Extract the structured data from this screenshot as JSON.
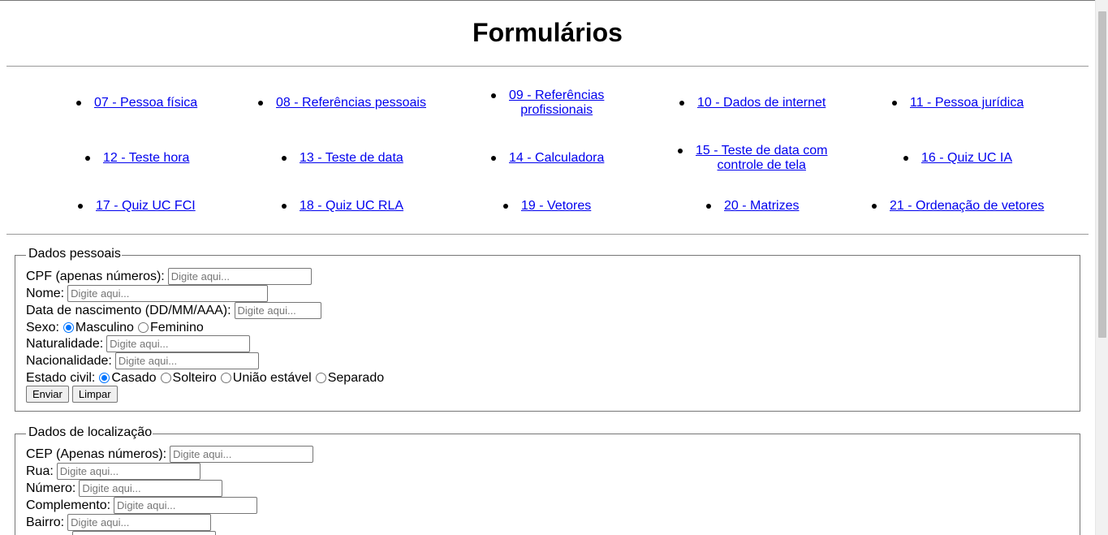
{
  "page": {
    "title": "Formulários"
  },
  "nav": {
    "links": [
      "07 - Pessoa física",
      "08 - Referências pessoais",
      [
        "09 - Referências",
        "profissionais"
      ],
      "10 - Dados de internet",
      "11 - Pessoa jurídica",
      "12 - Teste hora",
      "13 - Teste de data",
      "14 - Calculadora",
      [
        "15 - Teste de data com",
        "controle de tela"
      ],
      "16 - Quiz UC IA",
      "17 - Quiz UC FCI",
      "18 - Quiz UC RLA",
      "19 - Vetores",
      "20 - Matrizes",
      "21 - Ordenação de vetores"
    ]
  },
  "personal": {
    "legend": "Dados pessoais",
    "cpf_label": "CPF (apenas números):",
    "nome_label": "Nome:",
    "nascimento_label": "Data de nascimento (DD/MM/AAA):",
    "sexo_label": "Sexo:",
    "sexo_options": [
      "Masculino",
      "Feminino"
    ],
    "sexo_selected": "Masculino",
    "naturalidade_label": "Naturalidade:",
    "nacionalidade_label": "Nacionalidade:",
    "estado_civil_label": "Estado civil:",
    "estado_civil_options": [
      "Casado",
      "Solteiro",
      "União estável",
      "Separado"
    ],
    "estado_civil_selected": "Casado",
    "submit_label": "Enviar",
    "reset_label": "Limpar"
  },
  "location": {
    "legend": "Dados de localização",
    "cep_label": "CEP (Apenas números):",
    "rua_label": "Rua:",
    "numero_label": "Número:",
    "complemento_label": "Complemento:",
    "bairro_label": "Bairro:"
  },
  "placeholder": "Digite aqui..."
}
